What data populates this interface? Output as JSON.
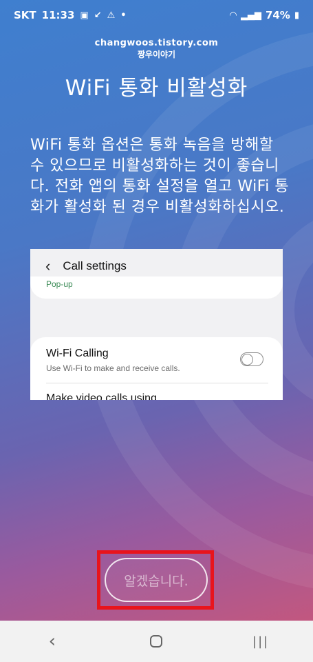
{
  "status_bar": {
    "carrier": "SKT",
    "time": "11:33",
    "notif_icons": [
      "image-icon",
      "missed-call-icon",
      "warning-icon",
      "dot-icon"
    ],
    "battery": "74%"
  },
  "watermark": {
    "site": "changwoos.tistory.com",
    "name": "짱우이야기"
  },
  "title": "WiFi 통화 비활성화",
  "description": "WiFi 통화 옵션은 통화 녹음을 방해할 수 있으므로 비활성화하는 것이 좋습니다. 전화 앱의 통화 설정을 열고 WiFi 통화가 활성화 된 경우 비활성화하십시오.",
  "preview": {
    "header": "Call settings",
    "popup": "Pop-up",
    "wifi_calling_title": "Wi-Fi Calling",
    "wifi_calling_sub": "Use Wi-Fi to make and receive calls.",
    "wifi_calling_on": false,
    "next_item": "Make video calls using"
  },
  "ok_button": "알겠습니다.",
  "highlight_color": "#e8141c",
  "nav": {
    "back": "‹",
    "recent": "|||"
  }
}
